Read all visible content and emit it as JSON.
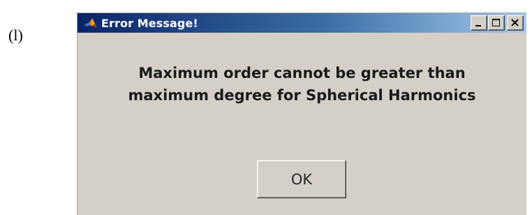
{
  "figure_label": "(l)",
  "window": {
    "title": "Error Message!",
    "icon": "matlab-icon",
    "controls": {
      "minimize_icon": "minimize-icon",
      "maximize_icon": "maximize-icon",
      "close_icon": "close-icon"
    }
  },
  "message": {
    "line1": "Maximum order cannot be greater than",
    "line2": "maximum degree for Spherical Harmonics"
  },
  "buttons": {
    "ok_label": "OK"
  },
  "colors": {
    "dialog_background": "#d4d0c8",
    "title_bar_start": "#0a246a",
    "title_bar_end": "#a6caf0",
    "title_text": "#ffffff"
  }
}
